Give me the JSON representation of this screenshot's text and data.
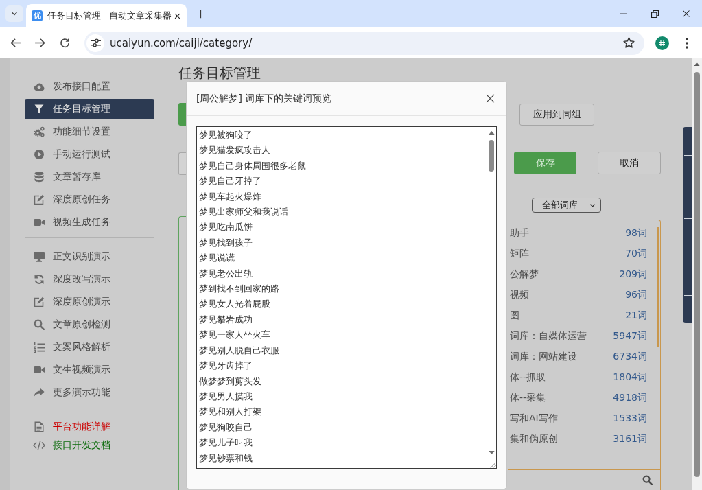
{
  "browser": {
    "tab": {
      "favicon_text": "优",
      "title": "任务目标管理 - 自动文章采集器",
      "selected": true
    },
    "url": "ucaiyun.com/caiji/category/"
  },
  "sidebar": {
    "groups": [
      {
        "items": [
          {
            "label": "发布接口配置",
            "selected": false
          },
          {
            "label": "任务目标管理",
            "selected": true
          },
          {
            "label": "功能细节设置",
            "selected": false
          },
          {
            "label": "手动运行测试",
            "selected": false
          },
          {
            "label": "文章暂存库",
            "selected": false
          },
          {
            "label": "深度原创任务",
            "selected": false
          },
          {
            "label": "视频生成任务",
            "selected": false
          }
        ]
      },
      {
        "items": [
          {
            "label": "正文识别演示",
            "selected": false
          },
          {
            "label": "深度改写演示",
            "selected": false
          },
          {
            "label": "深度原创演示",
            "selected": false
          },
          {
            "label": "文章原创检测",
            "selected": false
          },
          {
            "label": "文案风格解析",
            "selected": false
          },
          {
            "label": "文生视频演示",
            "selected": false
          },
          {
            "label": "更多演示功能",
            "selected": false
          }
        ]
      },
      {
        "items": [
          {
            "label": "平台功能详解",
            "selected": false,
            "color": "#cc0000"
          },
          {
            "label": "接口开发文档",
            "selected": false,
            "color": "#0b6b0b"
          }
        ]
      }
    ]
  },
  "main": {
    "title": "任务目标管理",
    "actions": [
      {
        "label": "应用到同组",
        "kind": "default"
      },
      {
        "label": "保存",
        "kind": "primary"
      },
      {
        "label": "取消",
        "kind": "default"
      }
    ],
    "library_filter": {
      "value": "全部词库"
    },
    "libraries": [
      {
        "name": "助手",
        "count": "98词"
      },
      {
        "name": "矩阵",
        "count": "70词"
      },
      {
        "name": "公解梦",
        "count": "209词"
      },
      {
        "name": "视频",
        "count": "96词"
      },
      {
        "name": "图",
        "count": "21词"
      },
      {
        "name": "词库：自媒体运营",
        "count": "5947词"
      },
      {
        "name": "词库：网站建设",
        "count": "6734词"
      },
      {
        "name": "体--抓取",
        "count": "1804词"
      },
      {
        "name": "体--采集",
        "count": "4918词"
      },
      {
        "name": "写和AI写作",
        "count": "1533词"
      },
      {
        "name": "集和伪原创",
        "count": "3161词"
      }
    ]
  },
  "dialog": {
    "title": "[周公解梦] 词库下的关键词预览",
    "keywords": [
      "梦见被狗咬了",
      "梦见猫发疯攻击人",
      "梦见自己身体周围很多老鼠",
      "梦见自己牙掉了",
      "梦见车起火爆炸",
      "梦见出家师父和我说话",
      "梦见吃南瓜饼",
      "梦见找到孩子",
      "梦见说谎",
      "梦见老公出轨",
      "梦到找不到回家的路",
      "梦见女人光着屁股",
      "梦见攀岩成功",
      "梦见一家人坐火车",
      "梦见别人脱自己衣服",
      "梦见牙齿掉了",
      "做梦梦到剪头发",
      "梦见男人摸我",
      "梦见和别人打架",
      "梦见狗咬自己",
      "梦见儿子叫我",
      "梦见钞票和钱"
    ]
  }
}
